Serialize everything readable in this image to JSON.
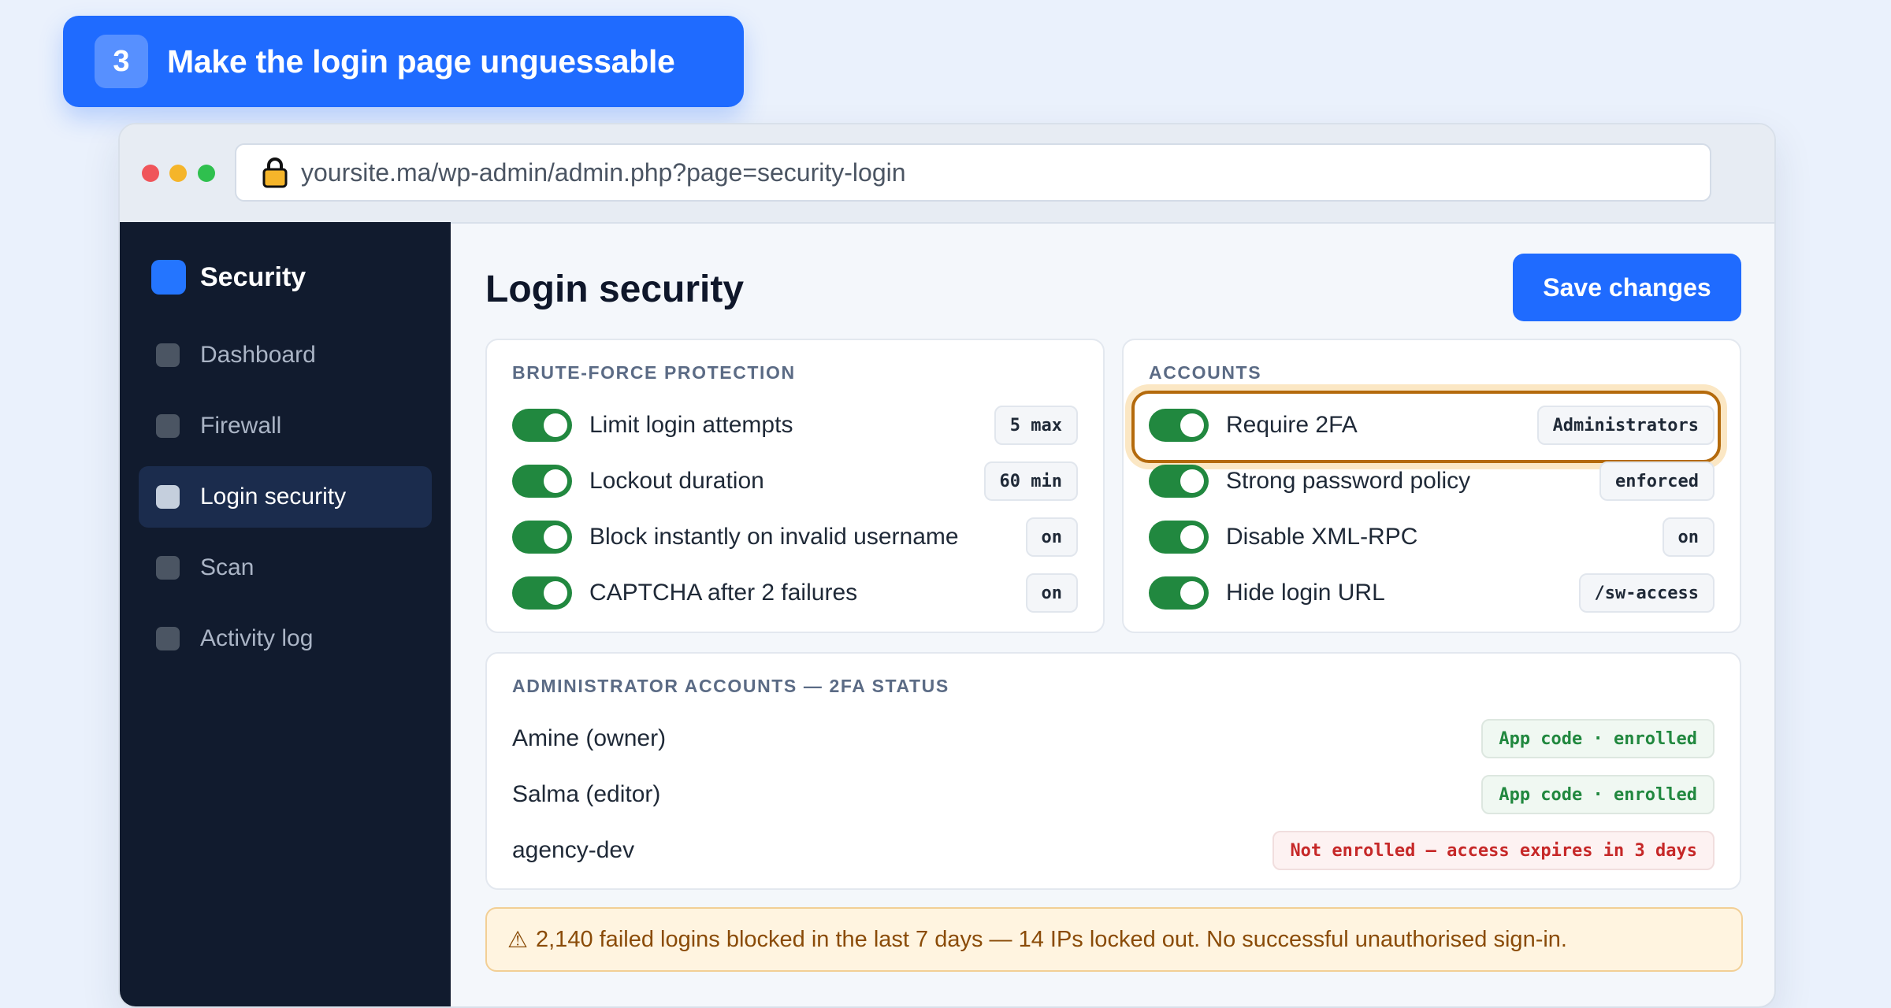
{
  "banner": {
    "step": "3",
    "title": "Make the login page unguessable"
  },
  "browser": {
    "url": "yoursite.ma/wp-admin/admin.php?page=security-login"
  },
  "sidebar": {
    "brand": "Security",
    "items": [
      {
        "label": "Dashboard",
        "active": false
      },
      {
        "label": "Firewall",
        "active": false
      },
      {
        "label": "Login security",
        "active": true
      },
      {
        "label": "Scan",
        "active": false
      },
      {
        "label": "Activity log",
        "active": false
      }
    ]
  },
  "main": {
    "title": "Login security",
    "save_label": "Save changes",
    "brute_force": {
      "title": "BRUTE-FORCE PROTECTION",
      "rows": [
        {
          "label": "Limit login attempts",
          "value": "5 max",
          "enabled": true
        },
        {
          "label": "Lockout duration",
          "value": "60 min",
          "enabled": true
        },
        {
          "label": "Block instantly on invalid username",
          "value": "on",
          "enabled": true
        },
        {
          "label": "CAPTCHA after 2 failures",
          "value": "on",
          "enabled": true
        }
      ]
    },
    "accounts": {
      "title": "ACCOUNTS",
      "rows": [
        {
          "label": "Require 2FA",
          "value": "Administrators",
          "enabled": true
        },
        {
          "label": "Strong password policy",
          "value": "enforced",
          "enabled": true
        },
        {
          "label": "Disable XML-RPC",
          "value": "on",
          "enabled": true
        },
        {
          "label": "Hide login URL",
          "value": "/sw-access",
          "enabled": true
        }
      ]
    },
    "admins": {
      "title": "ADMINISTRATOR ACCOUNTS — 2FA STATUS",
      "rows": [
        {
          "name": "Amine (owner)",
          "status": "App code · enrolled"
        },
        {
          "name": "Salma (editor)",
          "status": "App code · enrolled"
        },
        {
          "name": "agency-dev",
          "status": "Not enrolled — access expires in 3 days"
        }
      ]
    },
    "alert": {
      "icon": "⚠",
      "text": "2,140 failed logins blocked in the last 7 days — 14 IPs locked out. No successful unauthorised sign-in."
    }
  },
  "colors": {
    "accent": "#1f6bff",
    "toggle_on": "#21883f",
    "highlight": "#b46a0c",
    "danger": "#c62828"
  }
}
